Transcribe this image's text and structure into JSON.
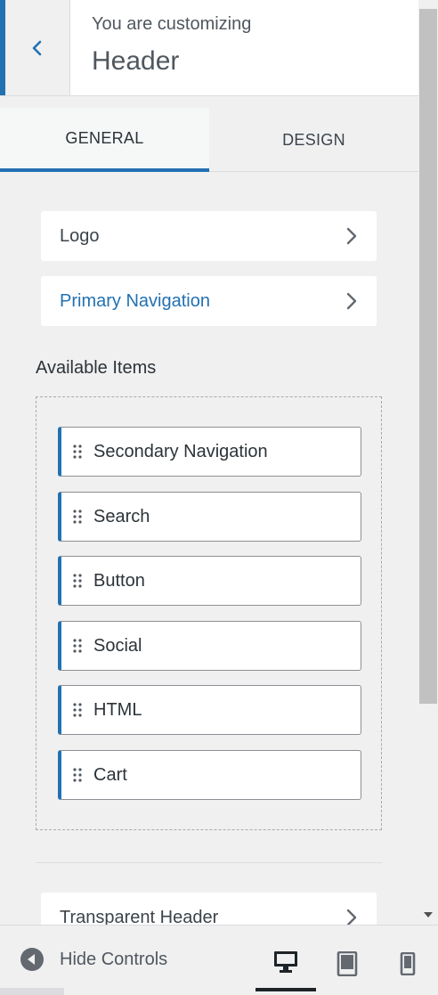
{
  "header": {
    "subtitle": "You are customizing",
    "title": "Header",
    "back_icon": "chevron-left-icon"
  },
  "tabs": [
    {
      "label": "GENERAL",
      "active": true
    },
    {
      "label": "DESIGN",
      "active": false
    }
  ],
  "rows": [
    {
      "label": "Logo"
    },
    {
      "label": "Primary Navigation"
    },
    {
      "label": "Transparent Header"
    }
  ],
  "available": {
    "title": "Available Items",
    "items": [
      "Secondary Navigation",
      "Search",
      "Button",
      "Social",
      "HTML",
      "Cart"
    ]
  },
  "footer": {
    "hide_label": "Hide Controls",
    "devices": [
      "desktop-icon",
      "tablet-icon",
      "mobile-icon"
    ],
    "active_device": "desktop"
  },
  "colors": {
    "accent": "#2271b1",
    "text": "#3c434a",
    "background": "#f0f0f1"
  }
}
